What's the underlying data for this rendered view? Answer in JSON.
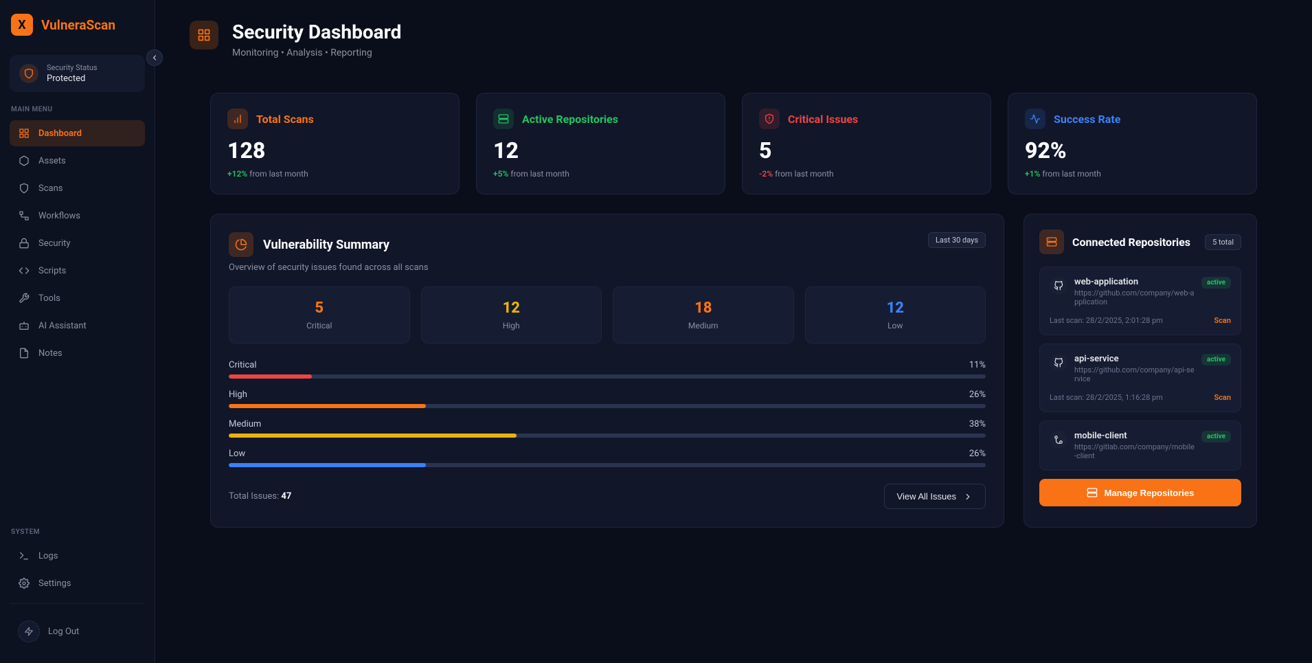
{
  "app": {
    "name": "VulneraScan",
    "logo_letter": "X"
  },
  "status": {
    "label": "Security Status",
    "value": "Protected"
  },
  "menu": {
    "main_label": "MAIN MENU",
    "system_label": "SYSTEM",
    "items": [
      {
        "label": "Dashboard"
      },
      {
        "label": "Assets"
      },
      {
        "label": "Scans"
      },
      {
        "label": "Workflows"
      },
      {
        "label": "Security"
      },
      {
        "label": "Scripts"
      },
      {
        "label": "Tools"
      },
      {
        "label": "AI Assistant"
      },
      {
        "label": "Notes"
      }
    ],
    "system": [
      {
        "label": "Logs"
      },
      {
        "label": "Settings"
      }
    ],
    "logout": "Log Out"
  },
  "header": {
    "title": "Security Dashboard",
    "subtitle": "Monitoring • Analysis • Reporting"
  },
  "stats": [
    {
      "label": "Total Scans",
      "value": "128",
      "change_val": "+12%",
      "change_rest": " from last month",
      "color": "orange",
      "change_color": "green"
    },
    {
      "label": "Active Repositories",
      "value": "12",
      "change_val": "+5%",
      "change_rest": " from last month",
      "color": "green",
      "change_color": "green"
    },
    {
      "label": "Critical Issues",
      "value": "5",
      "change_val": "-2%",
      "change_rest": " from last month",
      "color": "red",
      "change_color": "red"
    },
    {
      "label": "Success Rate",
      "value": "92%",
      "change_val": "+1%",
      "change_rest": " from last month",
      "color": "blue",
      "change_color": "green"
    }
  ],
  "vuln": {
    "title": "Vulnerability Summary",
    "subtitle": "Overview of security issues found across all scans",
    "period": "Last 30 days",
    "severities": [
      {
        "label": "Critical",
        "count": "5",
        "pct": "11%",
        "color": "#f97316"
      },
      {
        "label": "High",
        "count": "12",
        "pct": "26%",
        "color": "#eab308"
      },
      {
        "label": "Medium",
        "count": "18",
        "pct": "38%",
        "color": "#f97316"
      },
      {
        "label": "Low",
        "count": "12",
        "pct": "26%",
        "color": "#3b82f6"
      }
    ],
    "sev_colors": [
      "#f97316",
      "#eab308",
      "#f97316",
      "#3b82f6"
    ],
    "bar_colors": [
      "#ef4444",
      "#f97316",
      "#eab308",
      "#3b82f6"
    ],
    "total_label": "Total Issues: ",
    "total_value": "47",
    "view_all": "View All Issues"
  },
  "repos": {
    "title": "Connected Repositories",
    "count_badge": "5 total",
    "items": [
      {
        "name": "web-application",
        "url": "https://github.com/company/web-application",
        "status": "active",
        "scan_prefix": "Last scan: ",
        "scan_time": "28/2/2025, 2:01:28 pm",
        "scan_action": "Scan",
        "show_foot": true
      },
      {
        "name": "api-service",
        "url": "https://github.com/company/api-service",
        "status": "active",
        "scan_prefix": "Last scan: ",
        "scan_time": "28/2/2025, 1:16:28 pm",
        "scan_action": "Scan",
        "show_foot": true
      },
      {
        "name": "mobile-client",
        "url": "https://gitlab.com/company/mobile-client",
        "status": "active",
        "show_foot": false
      }
    ],
    "manage": "Manage Repositories"
  },
  "chart_data": {
    "type": "bar",
    "title": "Vulnerability Summary",
    "categories": [
      "Critical",
      "High",
      "Medium",
      "Low"
    ],
    "series": [
      {
        "name": "count",
        "values": [
          5,
          12,
          18,
          12
        ]
      },
      {
        "name": "percent",
        "values": [
          11,
          26,
          38,
          26
        ]
      }
    ],
    "total": 47
  }
}
